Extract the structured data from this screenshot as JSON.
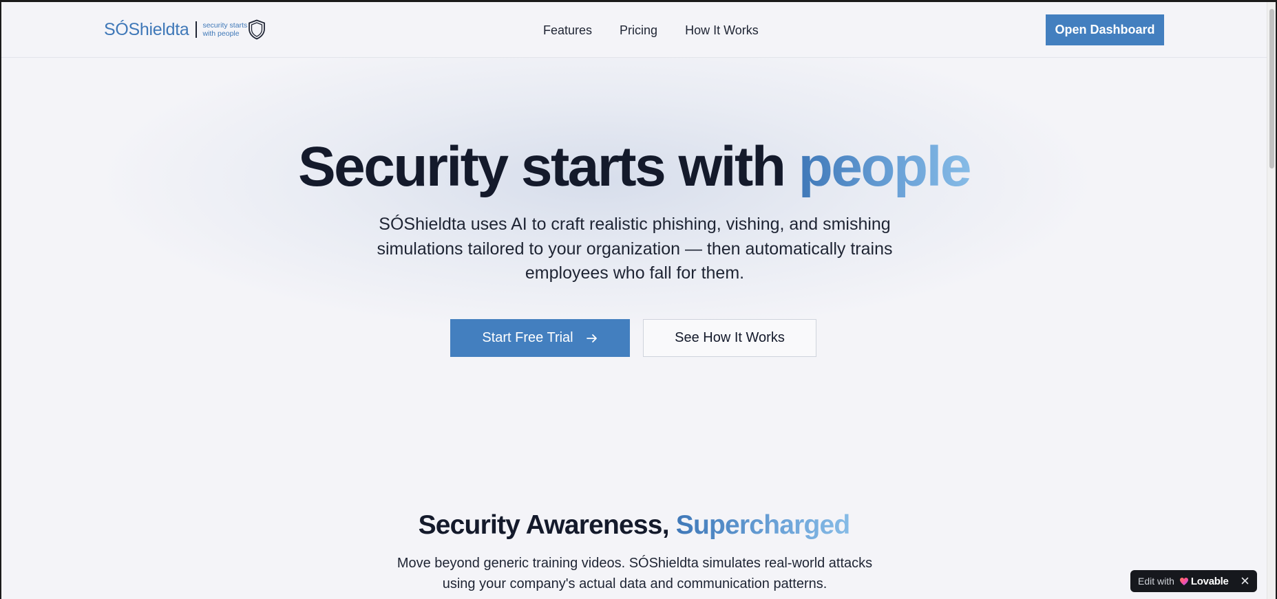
{
  "header": {
    "logo": {
      "wordmark": "SÓShieldta",
      "tagline": "security starts with people"
    },
    "nav": [
      "Features",
      "Pricing",
      "How It Works"
    ],
    "dashboard_label": "Open Dashboard"
  },
  "hero": {
    "title_main": "Security starts with ",
    "title_accent": "people",
    "subtitle": "SÓShieldta uses AI to craft realistic phishing, vishing, and smishing simulations tailored to your organization — then automatically trains employees who fall for them.",
    "primary_label": "Start Free Trial",
    "secondary_label": "See How It Works"
  },
  "section": {
    "title_main": "Security Awareness, ",
    "title_accent": "Supercharged",
    "subtitle": "Move beyond generic training videos. SÓShieldta simulates real-world attacks using your company's actual data and communication patterns."
  },
  "badge": {
    "edit_label": "Edit with",
    "brand": "Lovable"
  },
  "colors": {
    "accent": "#437fbf",
    "accent_light": "#86bbe6",
    "heading": "#141a2b",
    "background": "#f4f4f8"
  }
}
